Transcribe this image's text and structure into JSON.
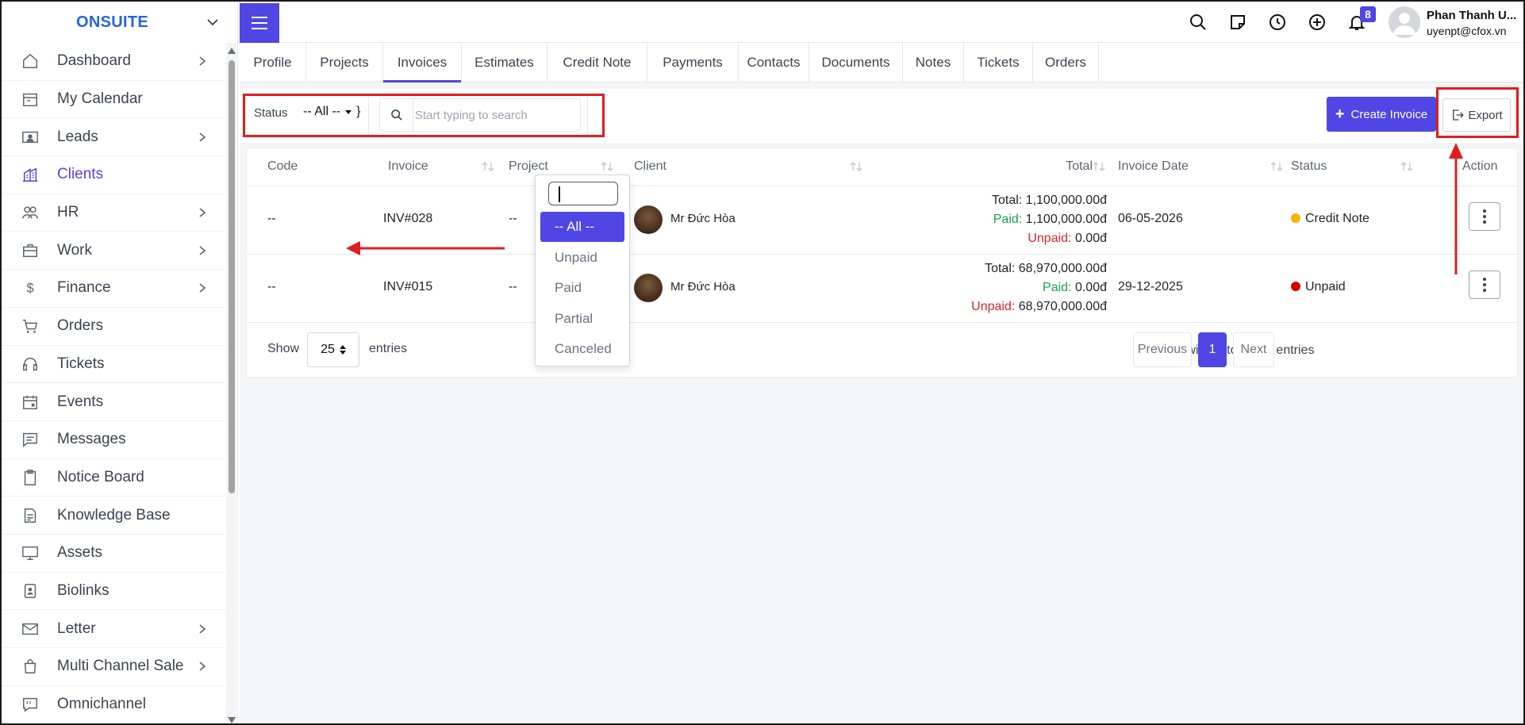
{
  "brand": {
    "name": "ONSUITE"
  },
  "sidebar": {
    "items": [
      {
        "label": "Dashboard",
        "icon": "home-icon",
        "arrow": true
      },
      {
        "label": "My Calendar",
        "icon": "calendar-icon",
        "arrow": false
      },
      {
        "label": "Leads",
        "icon": "id-card-icon",
        "arrow": true
      },
      {
        "label": "Clients",
        "icon": "building-icon",
        "arrow": false,
        "active": true
      },
      {
        "label": "HR",
        "icon": "users-icon",
        "arrow": true
      },
      {
        "label": "Work",
        "icon": "briefcase-icon",
        "arrow": true
      },
      {
        "label": "Finance",
        "icon": "dollar-icon",
        "arrow": true
      },
      {
        "label": "Orders",
        "icon": "cart-icon",
        "arrow": false
      },
      {
        "label": "Tickets",
        "icon": "headset-icon",
        "arrow": false
      },
      {
        "label": "Events",
        "icon": "calendar-event-icon",
        "arrow": false
      },
      {
        "label": "Messages",
        "icon": "message-icon",
        "arrow": false
      },
      {
        "label": "Notice Board",
        "icon": "clipboard-icon",
        "arrow": false
      },
      {
        "label": "Knowledge Base",
        "icon": "document-icon",
        "arrow": false
      },
      {
        "label": "Assets",
        "icon": "monitor-icon",
        "arrow": false
      },
      {
        "label": "Biolinks",
        "icon": "badge-icon",
        "arrow": false
      },
      {
        "label": "Letter",
        "icon": "mail-icon",
        "arrow": true
      },
      {
        "label": "Multi Channel Sale",
        "icon": "bag-icon",
        "arrow": true
      },
      {
        "label": "Omnichannel",
        "icon": "chat-icon",
        "arrow": false
      }
    ]
  },
  "topbar": {
    "notification_count": "8",
    "user_name": "Phan Thanh U...",
    "user_email": "uyenpt@cfox.vn"
  },
  "tabs": [
    {
      "label": "Profile"
    },
    {
      "label": "Projects"
    },
    {
      "label": "Invoices",
      "active": true
    },
    {
      "label": "Estimates"
    },
    {
      "label": "Credit Note"
    },
    {
      "label": "Payments"
    },
    {
      "label": "Contacts"
    },
    {
      "label": "Documents"
    },
    {
      "label": "Notes"
    },
    {
      "label": "Tickets"
    },
    {
      "label": "Orders"
    }
  ],
  "filters": {
    "status_label": "Status",
    "status_value": "-- All --",
    "search_placeholder": "Start typing to search",
    "create_label": "Create Invoice",
    "export_label": "Export"
  },
  "dropdown": {
    "options": [
      "-- All --",
      "Unpaid",
      "Paid",
      "Partial",
      "Canceled"
    ],
    "selected": "-- All --"
  },
  "table": {
    "columns": [
      "Code",
      "Invoice",
      "Project",
      "Client",
      "Total",
      "Invoice Date",
      "Status",
      "Action"
    ],
    "rows": [
      {
        "code": "--",
        "invoice": "INV#028",
        "project": "--",
        "client": "Mr Đức Hòa",
        "total_label": "Total:",
        "total": "1,100,000.00đ",
        "paid_label": "Paid:",
        "paid": "1,100,000.00đ",
        "unpaid_label": "Unpaid:",
        "unpaid": "0.00đ",
        "date": "06-05-2026",
        "status": "Credit Note",
        "status_color": "#f5b400"
      },
      {
        "code": "--",
        "invoice": "INV#015",
        "project": "--",
        "client": "Mr Đức Hòa",
        "total_label": "Total:",
        "total": "68,970,000.00đ",
        "paid_label": "Paid:",
        "paid": "0.00đ",
        "unpaid_label": "Unpaid:",
        "unpaid": "68,970,000.00đ",
        "date": "29-12-2025",
        "status": "Unpaid",
        "status_color": "#d40000"
      }
    ]
  },
  "pagination": {
    "show_label": "Show",
    "page_size": "25",
    "entries_label": "entries",
    "info": "Showing 1 to 2 of 2 entries",
    "previous": "Previous",
    "current": "1",
    "next": "Next"
  },
  "colors": {
    "accent": "#4f46e5",
    "annotation": "#e11d1d",
    "paid": "#16a34a",
    "unpaid": "#dc2626"
  }
}
